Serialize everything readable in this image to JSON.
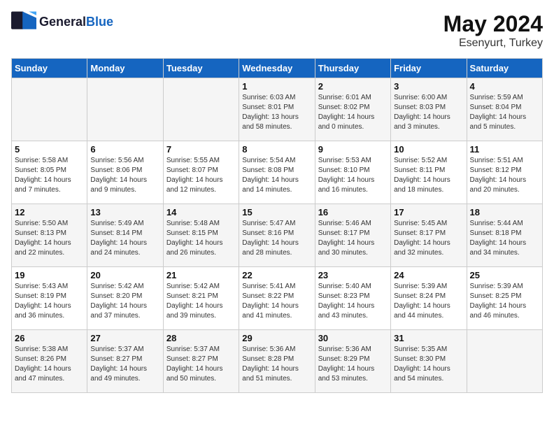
{
  "logo": {
    "general": "General",
    "blue": "Blue"
  },
  "title": "May 2024",
  "subtitle": "Esenyurt, Turkey",
  "days": [
    "Sunday",
    "Monday",
    "Tuesday",
    "Wednesday",
    "Thursday",
    "Friday",
    "Saturday"
  ],
  "weeks": [
    {
      "cells": [
        {
          "day": "",
          "content": ""
        },
        {
          "day": "",
          "content": ""
        },
        {
          "day": "",
          "content": ""
        },
        {
          "day": "1",
          "content": "Sunrise: 6:03 AM\nSunset: 8:01 PM\nDaylight: 13 hours\nand 58 minutes."
        },
        {
          "day": "2",
          "content": "Sunrise: 6:01 AM\nSunset: 8:02 PM\nDaylight: 14 hours\nand 0 minutes."
        },
        {
          "day": "3",
          "content": "Sunrise: 6:00 AM\nSunset: 8:03 PM\nDaylight: 14 hours\nand 3 minutes."
        },
        {
          "day": "4",
          "content": "Sunrise: 5:59 AM\nSunset: 8:04 PM\nDaylight: 14 hours\nand 5 minutes."
        }
      ]
    },
    {
      "cells": [
        {
          "day": "5",
          "content": "Sunrise: 5:58 AM\nSunset: 8:05 PM\nDaylight: 14 hours\nand 7 minutes."
        },
        {
          "day": "6",
          "content": "Sunrise: 5:56 AM\nSunset: 8:06 PM\nDaylight: 14 hours\nand 9 minutes."
        },
        {
          "day": "7",
          "content": "Sunrise: 5:55 AM\nSunset: 8:07 PM\nDaylight: 14 hours\nand 12 minutes."
        },
        {
          "day": "8",
          "content": "Sunrise: 5:54 AM\nSunset: 8:08 PM\nDaylight: 14 hours\nand 14 minutes."
        },
        {
          "day": "9",
          "content": "Sunrise: 5:53 AM\nSunset: 8:10 PM\nDaylight: 14 hours\nand 16 minutes."
        },
        {
          "day": "10",
          "content": "Sunrise: 5:52 AM\nSunset: 8:11 PM\nDaylight: 14 hours\nand 18 minutes."
        },
        {
          "day": "11",
          "content": "Sunrise: 5:51 AM\nSunset: 8:12 PM\nDaylight: 14 hours\nand 20 minutes."
        }
      ]
    },
    {
      "cells": [
        {
          "day": "12",
          "content": "Sunrise: 5:50 AM\nSunset: 8:13 PM\nDaylight: 14 hours\nand 22 minutes."
        },
        {
          "day": "13",
          "content": "Sunrise: 5:49 AM\nSunset: 8:14 PM\nDaylight: 14 hours\nand 24 minutes."
        },
        {
          "day": "14",
          "content": "Sunrise: 5:48 AM\nSunset: 8:15 PM\nDaylight: 14 hours\nand 26 minutes."
        },
        {
          "day": "15",
          "content": "Sunrise: 5:47 AM\nSunset: 8:16 PM\nDaylight: 14 hours\nand 28 minutes."
        },
        {
          "day": "16",
          "content": "Sunrise: 5:46 AM\nSunset: 8:17 PM\nDaylight: 14 hours\nand 30 minutes."
        },
        {
          "day": "17",
          "content": "Sunrise: 5:45 AM\nSunset: 8:17 PM\nDaylight: 14 hours\nand 32 minutes."
        },
        {
          "day": "18",
          "content": "Sunrise: 5:44 AM\nSunset: 8:18 PM\nDaylight: 14 hours\nand 34 minutes."
        }
      ]
    },
    {
      "cells": [
        {
          "day": "19",
          "content": "Sunrise: 5:43 AM\nSunset: 8:19 PM\nDaylight: 14 hours\nand 36 minutes."
        },
        {
          "day": "20",
          "content": "Sunrise: 5:42 AM\nSunset: 8:20 PM\nDaylight: 14 hours\nand 37 minutes."
        },
        {
          "day": "21",
          "content": "Sunrise: 5:42 AM\nSunset: 8:21 PM\nDaylight: 14 hours\nand 39 minutes."
        },
        {
          "day": "22",
          "content": "Sunrise: 5:41 AM\nSunset: 8:22 PM\nDaylight: 14 hours\nand 41 minutes."
        },
        {
          "day": "23",
          "content": "Sunrise: 5:40 AM\nSunset: 8:23 PM\nDaylight: 14 hours\nand 43 minutes."
        },
        {
          "day": "24",
          "content": "Sunrise: 5:39 AM\nSunset: 8:24 PM\nDaylight: 14 hours\nand 44 minutes."
        },
        {
          "day": "25",
          "content": "Sunrise: 5:39 AM\nSunset: 8:25 PM\nDaylight: 14 hours\nand 46 minutes."
        }
      ]
    },
    {
      "cells": [
        {
          "day": "26",
          "content": "Sunrise: 5:38 AM\nSunset: 8:26 PM\nDaylight: 14 hours\nand 47 minutes."
        },
        {
          "day": "27",
          "content": "Sunrise: 5:37 AM\nSunset: 8:27 PM\nDaylight: 14 hours\nand 49 minutes."
        },
        {
          "day": "28",
          "content": "Sunrise: 5:37 AM\nSunset: 8:27 PM\nDaylight: 14 hours\nand 50 minutes."
        },
        {
          "day": "29",
          "content": "Sunrise: 5:36 AM\nSunset: 8:28 PM\nDaylight: 14 hours\nand 51 minutes."
        },
        {
          "day": "30",
          "content": "Sunrise: 5:36 AM\nSunset: 8:29 PM\nDaylight: 14 hours\nand 53 minutes."
        },
        {
          "day": "31",
          "content": "Sunrise: 5:35 AM\nSunset: 8:30 PM\nDaylight: 14 hours\nand 54 minutes."
        },
        {
          "day": "",
          "content": ""
        }
      ]
    }
  ]
}
